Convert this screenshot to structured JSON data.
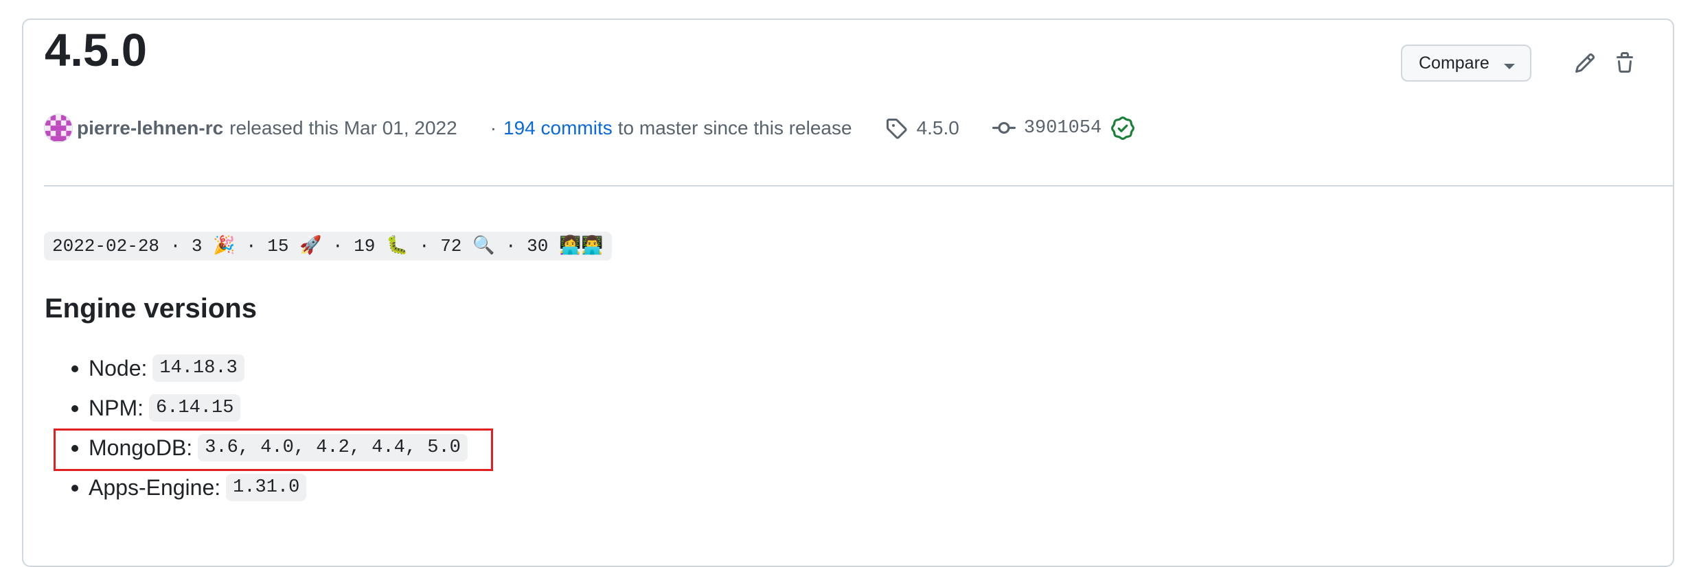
{
  "release": {
    "title": "4.5.0",
    "compare_label": "Compare",
    "author": "pierre-lehnen-rc",
    "released_text": "released this Mar 01, 2022",
    "commits_prefix": "·",
    "commits_link": "194 commits",
    "commits_suffix": "to master since this release",
    "tag": "4.5.0",
    "commit_sha": "3901054",
    "verified_color": "#1a7f37"
  },
  "stats_line": "2022-02-28 · 3 🎉 · 15 🚀 · 19 🐛 · 72 🔍 · 30 👩‍💻👨‍💻",
  "engine": {
    "heading": "Engine versions",
    "items": [
      {
        "label": "Node:",
        "value": "14.18.3"
      },
      {
        "label": "NPM:",
        "value": "6.14.15"
      },
      {
        "label": "MongoDB:",
        "value": "3.6, 4.0, 4.2, 4.4, 5.0"
      },
      {
        "label": "Apps-Engine:",
        "value": "1.31.0"
      }
    ]
  },
  "colors": {
    "link": "#0969da",
    "highlight": "#e02020",
    "border": "#d0d7de"
  }
}
